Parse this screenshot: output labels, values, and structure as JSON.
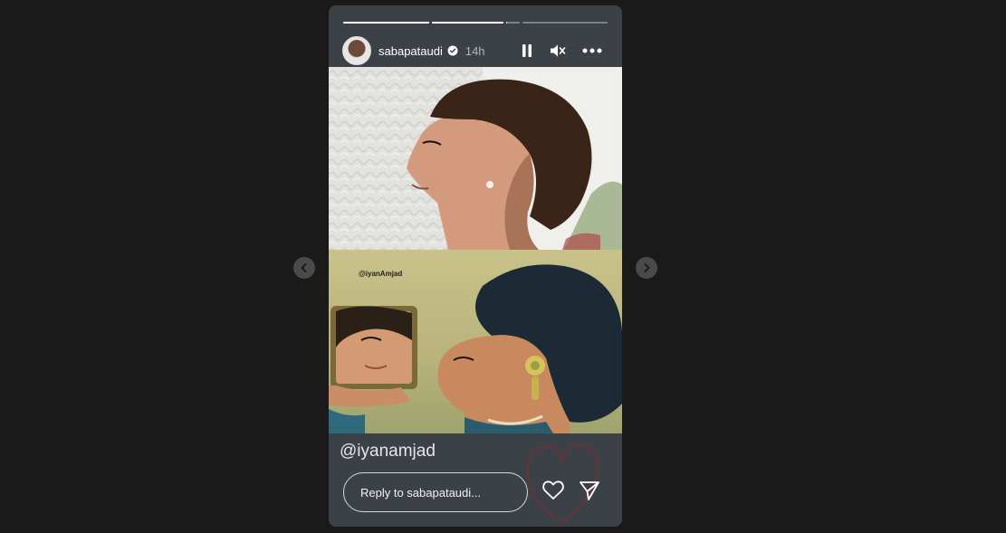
{
  "story": {
    "username": "sabapataudi",
    "time": "14h",
    "progress": [
      1,
      1,
      0.1,
      0
    ],
    "caption": "@iyanamjad",
    "watermark": "@iyanAmjad",
    "reply_placeholder": "Reply to sabapataudi..."
  },
  "icons": {
    "verified": "verified-badge-icon",
    "pause": "pause-icon",
    "mute": "muted-speaker-icon",
    "more": "more-options-icon",
    "like": "heart-icon",
    "share": "send-icon",
    "prev": "chevron-left-icon",
    "next": "chevron-right-icon"
  },
  "colors": {
    "background": "#1a1a1a",
    "story_bg": "#3b4147",
    "scribble": "#8a2a2a"
  }
}
